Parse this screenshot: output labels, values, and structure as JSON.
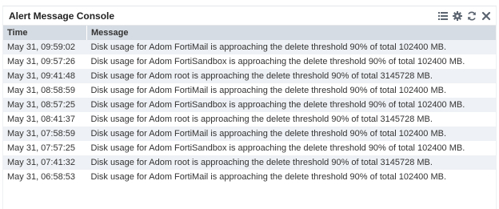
{
  "widget": {
    "title": "Alert Message Console",
    "tools": [
      {
        "name": "list-icon"
      },
      {
        "name": "gear-icon"
      },
      {
        "name": "refresh-icon"
      },
      {
        "name": "close-icon"
      }
    ],
    "icon_color": "#5b6470"
  },
  "table": {
    "headers": {
      "time": "Time",
      "message": "Message"
    },
    "rows": [
      {
        "time": "May 31, 09:59:02",
        "message": "Disk usage for Adom FortiMail is approaching the delete threshold 90% of total 102400 MB."
      },
      {
        "time": "May 31, 09:57:26",
        "message": "Disk usage for Adom FortiSandbox is approaching the delete threshold 90% of total 102400 MB."
      },
      {
        "time": "May 31, 09:41:48",
        "message": "Disk usage for Adom root is approaching the delete threshold 90% of total 3145728 MB."
      },
      {
        "time": "May 31, 08:58:59",
        "message": "Disk usage for Adom FortiMail is approaching the delete threshold 90% of total 102400 MB."
      },
      {
        "time": "May 31, 08:57:25",
        "message": "Disk usage for Adom FortiSandbox is approaching the delete threshold 90% of total 102400 MB."
      },
      {
        "time": "May 31, 08:41:37",
        "message": "Disk usage for Adom root is approaching the delete threshold 90% of total 3145728 MB."
      },
      {
        "time": "May 31, 07:58:59",
        "message": "Disk usage for Adom FortiMail is approaching the delete threshold 90% of total 102400 MB."
      },
      {
        "time": "May 31, 07:57:25",
        "message": "Disk usage for Adom FortiSandbox is approaching the delete threshold 90% of total 102400 MB."
      },
      {
        "time": "May 31, 07:41:32",
        "message": "Disk usage for Adom root is approaching the delete threshold 90% of total 3145728 MB."
      },
      {
        "time": "May 31, 06:58:53",
        "message": "Disk usage for Adom FortiMail is approaching the delete threshold 90% of total 102400 MB."
      }
    ]
  }
}
